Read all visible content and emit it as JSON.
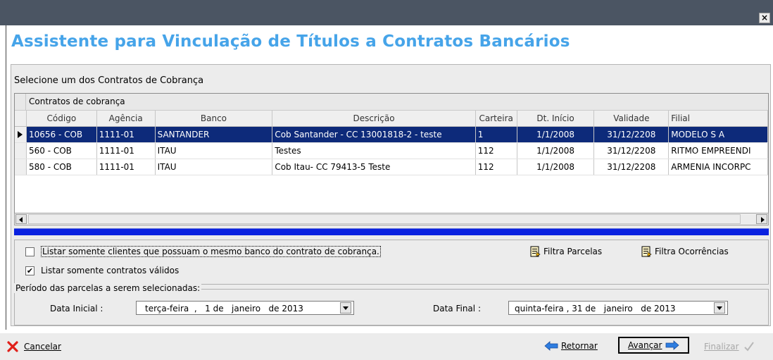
{
  "window": {
    "close_symbol": "×",
    "heading": "Assistente para Vinculação de Títulos a Contratos Bancários"
  },
  "select_prompt": "Selecione um dos Contratos de Cobrança",
  "grid": {
    "group_label": "Contratos de cobrança",
    "columns": [
      "Código",
      "Agência",
      "Banco",
      "Descrição",
      "Carteira",
      "Dt. Início",
      "Validade",
      "Filial"
    ],
    "rows": [
      [
        "10656 - COB",
        "1111-01",
        "SANTANDER",
        "Cob Santander - CC 13001818-2 - teste",
        "1",
        "1/1/2008",
        "31/12/2208",
        "MODELO S A"
      ],
      [
        "560 - COB",
        "1111-01",
        "ITAU",
        "Testes",
        "112",
        "1/1/2008",
        "31/12/2208",
        "RITMO EMPREENDI"
      ],
      [
        "580 - COB",
        "1111-01",
        "ITAU",
        "Cob Itau- CC 79413-5 Teste",
        "112",
        "1/1/2008",
        "31/12/2208",
        "ARMENIA INCORPC"
      ]
    ],
    "selected_row": 0
  },
  "options": {
    "same_bank_label": "Listar somente clientes que possuam o mesmo banco do contrato de cobrança.",
    "same_bank_checked": false,
    "valid_only_label": "Listar somente contratos válidos",
    "valid_only_checked": true,
    "filtra_parcelas": "Filtra Parcelas",
    "filtra_ocorrencias": "Filtra Ocorrências"
  },
  "periodo": {
    "title": "Período das parcelas a serem selecionadas:",
    "data_inicial_label": "Data Inicial :",
    "data_inicial_value": "terça-feira  ,   1 de   janeiro   de 2013",
    "data_final_label": "Data Final :",
    "data_final_value": "quinta-feira , 31 de   janeiro   de 2013"
  },
  "footer": {
    "cancelar": "Cancelar",
    "retornar": "Retornar",
    "avancar": "Avançar",
    "finalizar": "Finalizar"
  },
  "colors": {
    "heading": "#46a4e9",
    "selected_row": "#0d2a7a",
    "separator": "#0a21e0",
    "titlebar": "#4b5563"
  },
  "icons": [
    "close-icon",
    "document-icon",
    "cancel-x-icon",
    "arrow-left-icon",
    "arrow-right-icon",
    "checkmark-icon"
  ]
}
